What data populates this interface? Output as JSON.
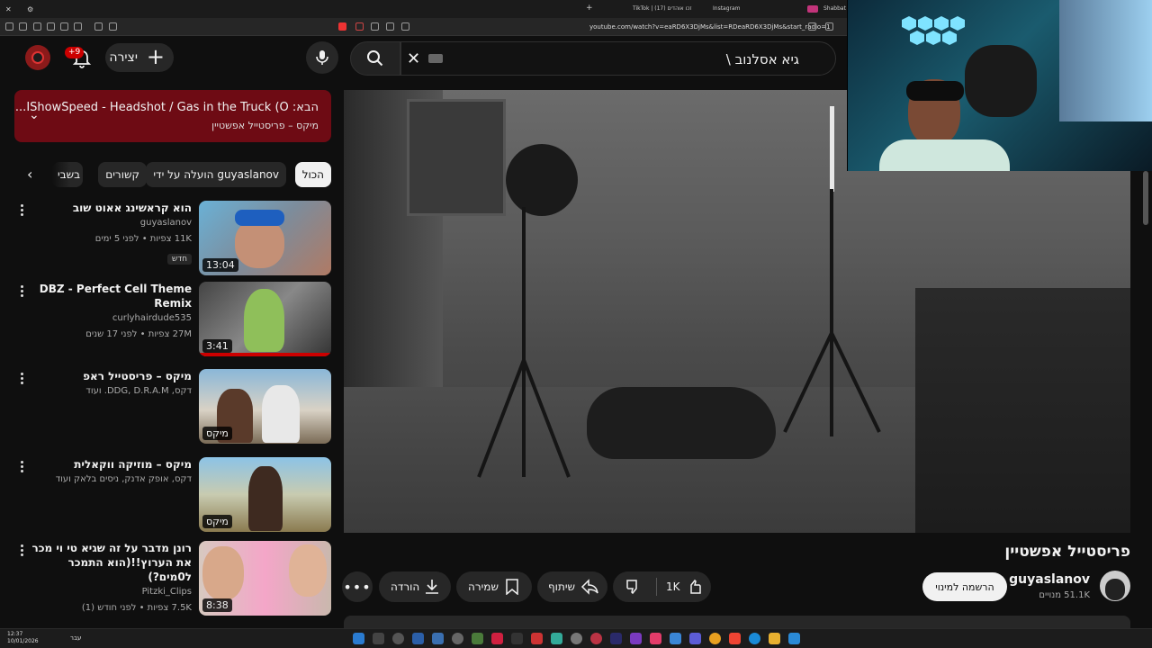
{
  "browser": {
    "tabs": [
      {
        "label": "TikTok | זכו אוהדים (17)"
      },
      {
        "label": "Instagram"
      },
      {
        "label": "Shabbat Sh"
      }
    ],
    "url": "youtube.com/watch?v=eaRD6X3DjMs&list=RDeaRD6X3DjMs&start_radio=1"
  },
  "header": {
    "search_value": "גיא אסלנוב \\",
    "create_label": "יצירה",
    "notification_count": "+9"
  },
  "next_up": {
    "prefix": "הבא:",
    "title": "IShowSpeed - Headshot / Gas in the Truck (O...",
    "subtitle": "מיקס – פריסטייל אפשטיין"
  },
  "chips": [
    "הכול",
    "הועלה על ידי guyaslanov",
    "קשורים",
    "בשבי"
  ],
  "recommendations": [
    {
      "title": "הוא קראשינג אאוט שוב",
      "channel": "guyaslanov",
      "meta": "11K צפיות • לפני 5 ימים",
      "badge": "חדש",
      "duration": "13:04"
    },
    {
      "title": "DBZ - Perfect Cell Theme Remix",
      "channel": "curlyhairdude535",
      "meta": "27M צפיות • לפני 17 שנים",
      "badge": "",
      "duration": "3:41"
    },
    {
      "title": "מיקס – פריסטייל ראפ",
      "channel": "דקס, DDG, D.R.A.M. ועוד",
      "meta": "",
      "badge": "",
      "duration": "מיקס"
    },
    {
      "title": "מיקס – מוזיקה ווקאלית",
      "channel": "דקס, אופק אדנק, ניסים בלאק ועוד",
      "meta": "",
      "badge": "",
      "duration": "מיקס"
    },
    {
      "title": "רונן מדבר על זה שגיא טי וי מכר את הערוץ!!(הוא התמכר ל0מים?)",
      "channel": "Pitzki_Clips",
      "meta": "7.5K צפיות • לפני חודש (1)",
      "badge": "",
      "duration": "8:38"
    }
  ],
  "video": {
    "title": "פריסטייל אפשטיין",
    "channel": "guyaslanov",
    "subscribers": "51.1K מנויים",
    "subscribe_label": "הרשמה למינוי",
    "likes": "1K",
    "share_label": "שיתוף",
    "save_label": "שמירה",
    "download_label": "הורדה"
  },
  "taskbar": {
    "time": "12:37",
    "date": "10/01/2026",
    "lang": "עבר"
  },
  "colors": {
    "accent": "#ff0000",
    "banner": "#6e0b14",
    "background": "#0f0f0f"
  }
}
